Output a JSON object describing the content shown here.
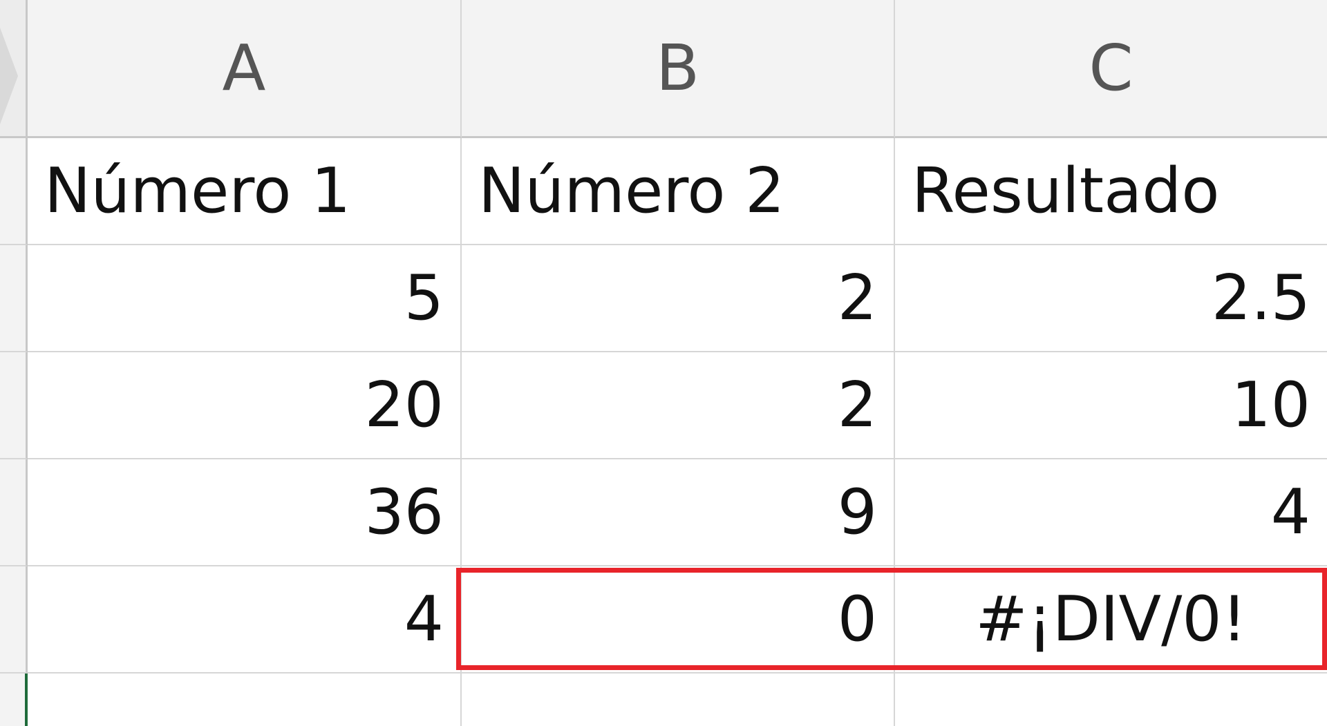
{
  "columns": [
    "A",
    "B",
    "C"
  ],
  "rows": [
    [
      "Número 1",
      "Número 2",
      "Resultado"
    ],
    [
      "5",
      "2",
      "2.5"
    ],
    [
      "20",
      "2",
      "10"
    ],
    [
      "36",
      "9",
      "4"
    ],
    [
      "4",
      "0",
      "#¡DIV/0!"
    ],
    [
      "",
      "",
      ""
    ]
  ],
  "colors": {
    "highlight": "#e8242a",
    "active_row_marker": "#1e6b3a",
    "header_bg": "#f3f3f3",
    "gridline": "#d6d6d6"
  }
}
